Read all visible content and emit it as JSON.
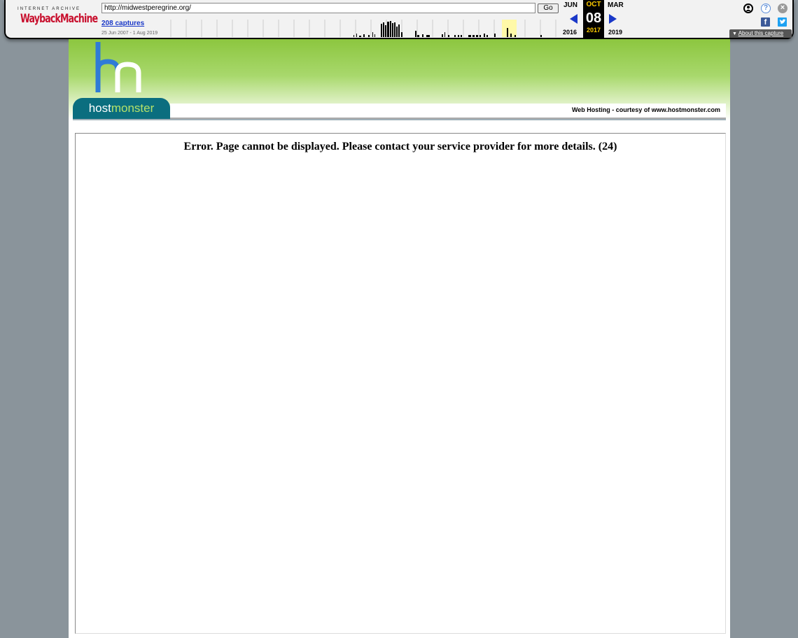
{
  "wayback": {
    "logo_top": "INTERNET ARCHIVE",
    "logo_main": "WaybackMachine",
    "url": "http://midwestperegrine.org/",
    "go_label": "Go",
    "captures": "208 captures",
    "range": "25 Jun 2007 - 1 Aug 2019",
    "calendar": {
      "prev_month": "JUN",
      "cur_month": "OCT",
      "next_month": "MAR",
      "day": "08",
      "prev_year": "2016",
      "cur_year": "2017",
      "next_year": "2019"
    },
    "about": "About this capture",
    "icons": {
      "user": "user-icon",
      "help": "help-icon",
      "close": "close-icon",
      "facebook": "facebook-icon",
      "twitter": "twitter-icon"
    },
    "colors": {
      "accent_blue": "#1a38c8",
      "year_highlight": "#ffcc00",
      "logo_red": "#c8102e"
    }
  },
  "host": {
    "logo_word1": "host",
    "logo_word2": "monster",
    "banner": "Web Hosting - courtesy of www.hostmonster.com",
    "colors": {
      "green": "#8cc63f",
      "teal": "#0b6e7f"
    }
  },
  "error": {
    "message": "Error. Page cannot be displayed. Please contact your service provider for more details. (24)"
  }
}
